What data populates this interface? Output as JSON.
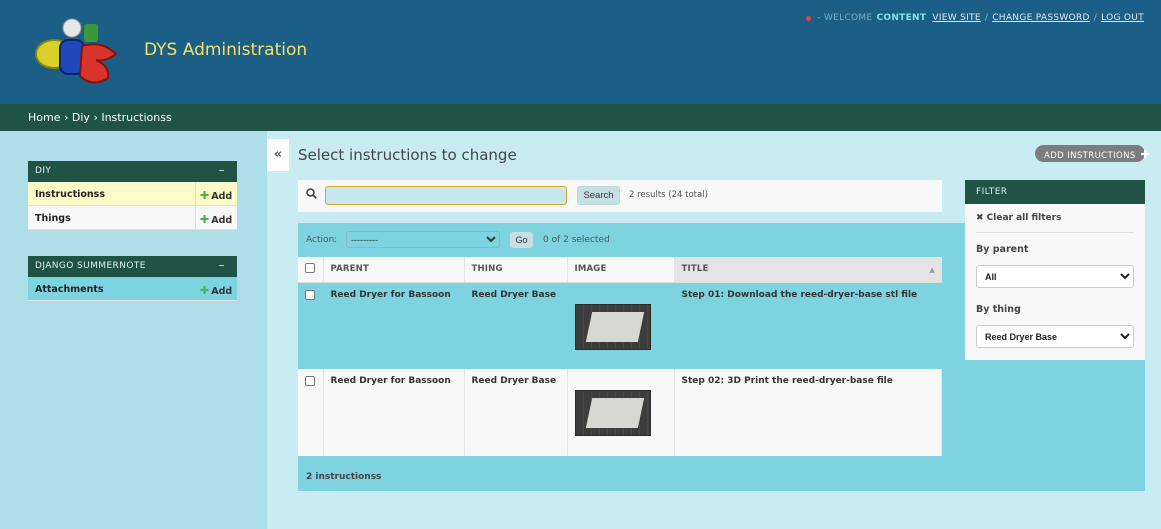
{
  "header": {
    "site_title": "DYS Administration",
    "welcome": "- WELCOME",
    "username": "CONTENT",
    "links": [
      "VIEW SITE",
      "CHANGE PASSWORD",
      "LOG OUT"
    ],
    "separator": "/"
  },
  "breadcrumbs": {
    "home": "Home",
    "app": "Diy",
    "current": "Instructionss",
    "separator": "›"
  },
  "sidebar": {
    "toggle_icon": "«",
    "modules": [
      {
        "caption": "DIY",
        "collapse": "–",
        "items": [
          {
            "name": "Instructionss",
            "add": "Add"
          },
          {
            "name": "Things",
            "add": "Add"
          }
        ]
      },
      {
        "caption": "DJANGO SUMMERNOTE",
        "collapse": "–",
        "items": [
          {
            "name": "Attachments",
            "add": "Add"
          }
        ]
      }
    ]
  },
  "content": {
    "title": "Select instructions to change",
    "add_button": "ADD INSTRUCTIONS",
    "search": {
      "value": "",
      "button": "Search",
      "results": "2 results (",
      "total": "24 total",
      "results_end": ")"
    },
    "actions": {
      "label": "Action:",
      "selected_option": "---------",
      "go": "Go",
      "selected_count": "0 of 2 selected"
    },
    "table": {
      "columns": [
        "PARENT",
        "THING",
        "IMAGE",
        "TITLE"
      ],
      "sort_icon": "▲",
      "rows": [
        {
          "parent": "Reed Dryer for Bassoon",
          "thing": "Reed Dryer Base",
          "title": "Step 01: Download the reed-dryer-base stl file"
        },
        {
          "parent": "Reed Dryer for Bassoon",
          "thing": "Reed Dryer Base",
          "title": "Step 02: 3D Print the reed-dryer-base file"
        }
      ]
    },
    "paginator": "2 instructionss"
  },
  "filter": {
    "caption": "FILTER",
    "clear": "✖ Clear all filters",
    "by_parent": {
      "label": "By parent",
      "selected": "All"
    },
    "by_thing": {
      "label": "By thing",
      "selected": "Reed Dryer Base"
    }
  },
  "colors": {
    "header_bg": "#1b5e86",
    "breadcrumb_bg": "#1f5344",
    "accent_teal": "#7dd3e0",
    "title_yellow": "#f5e06a"
  }
}
